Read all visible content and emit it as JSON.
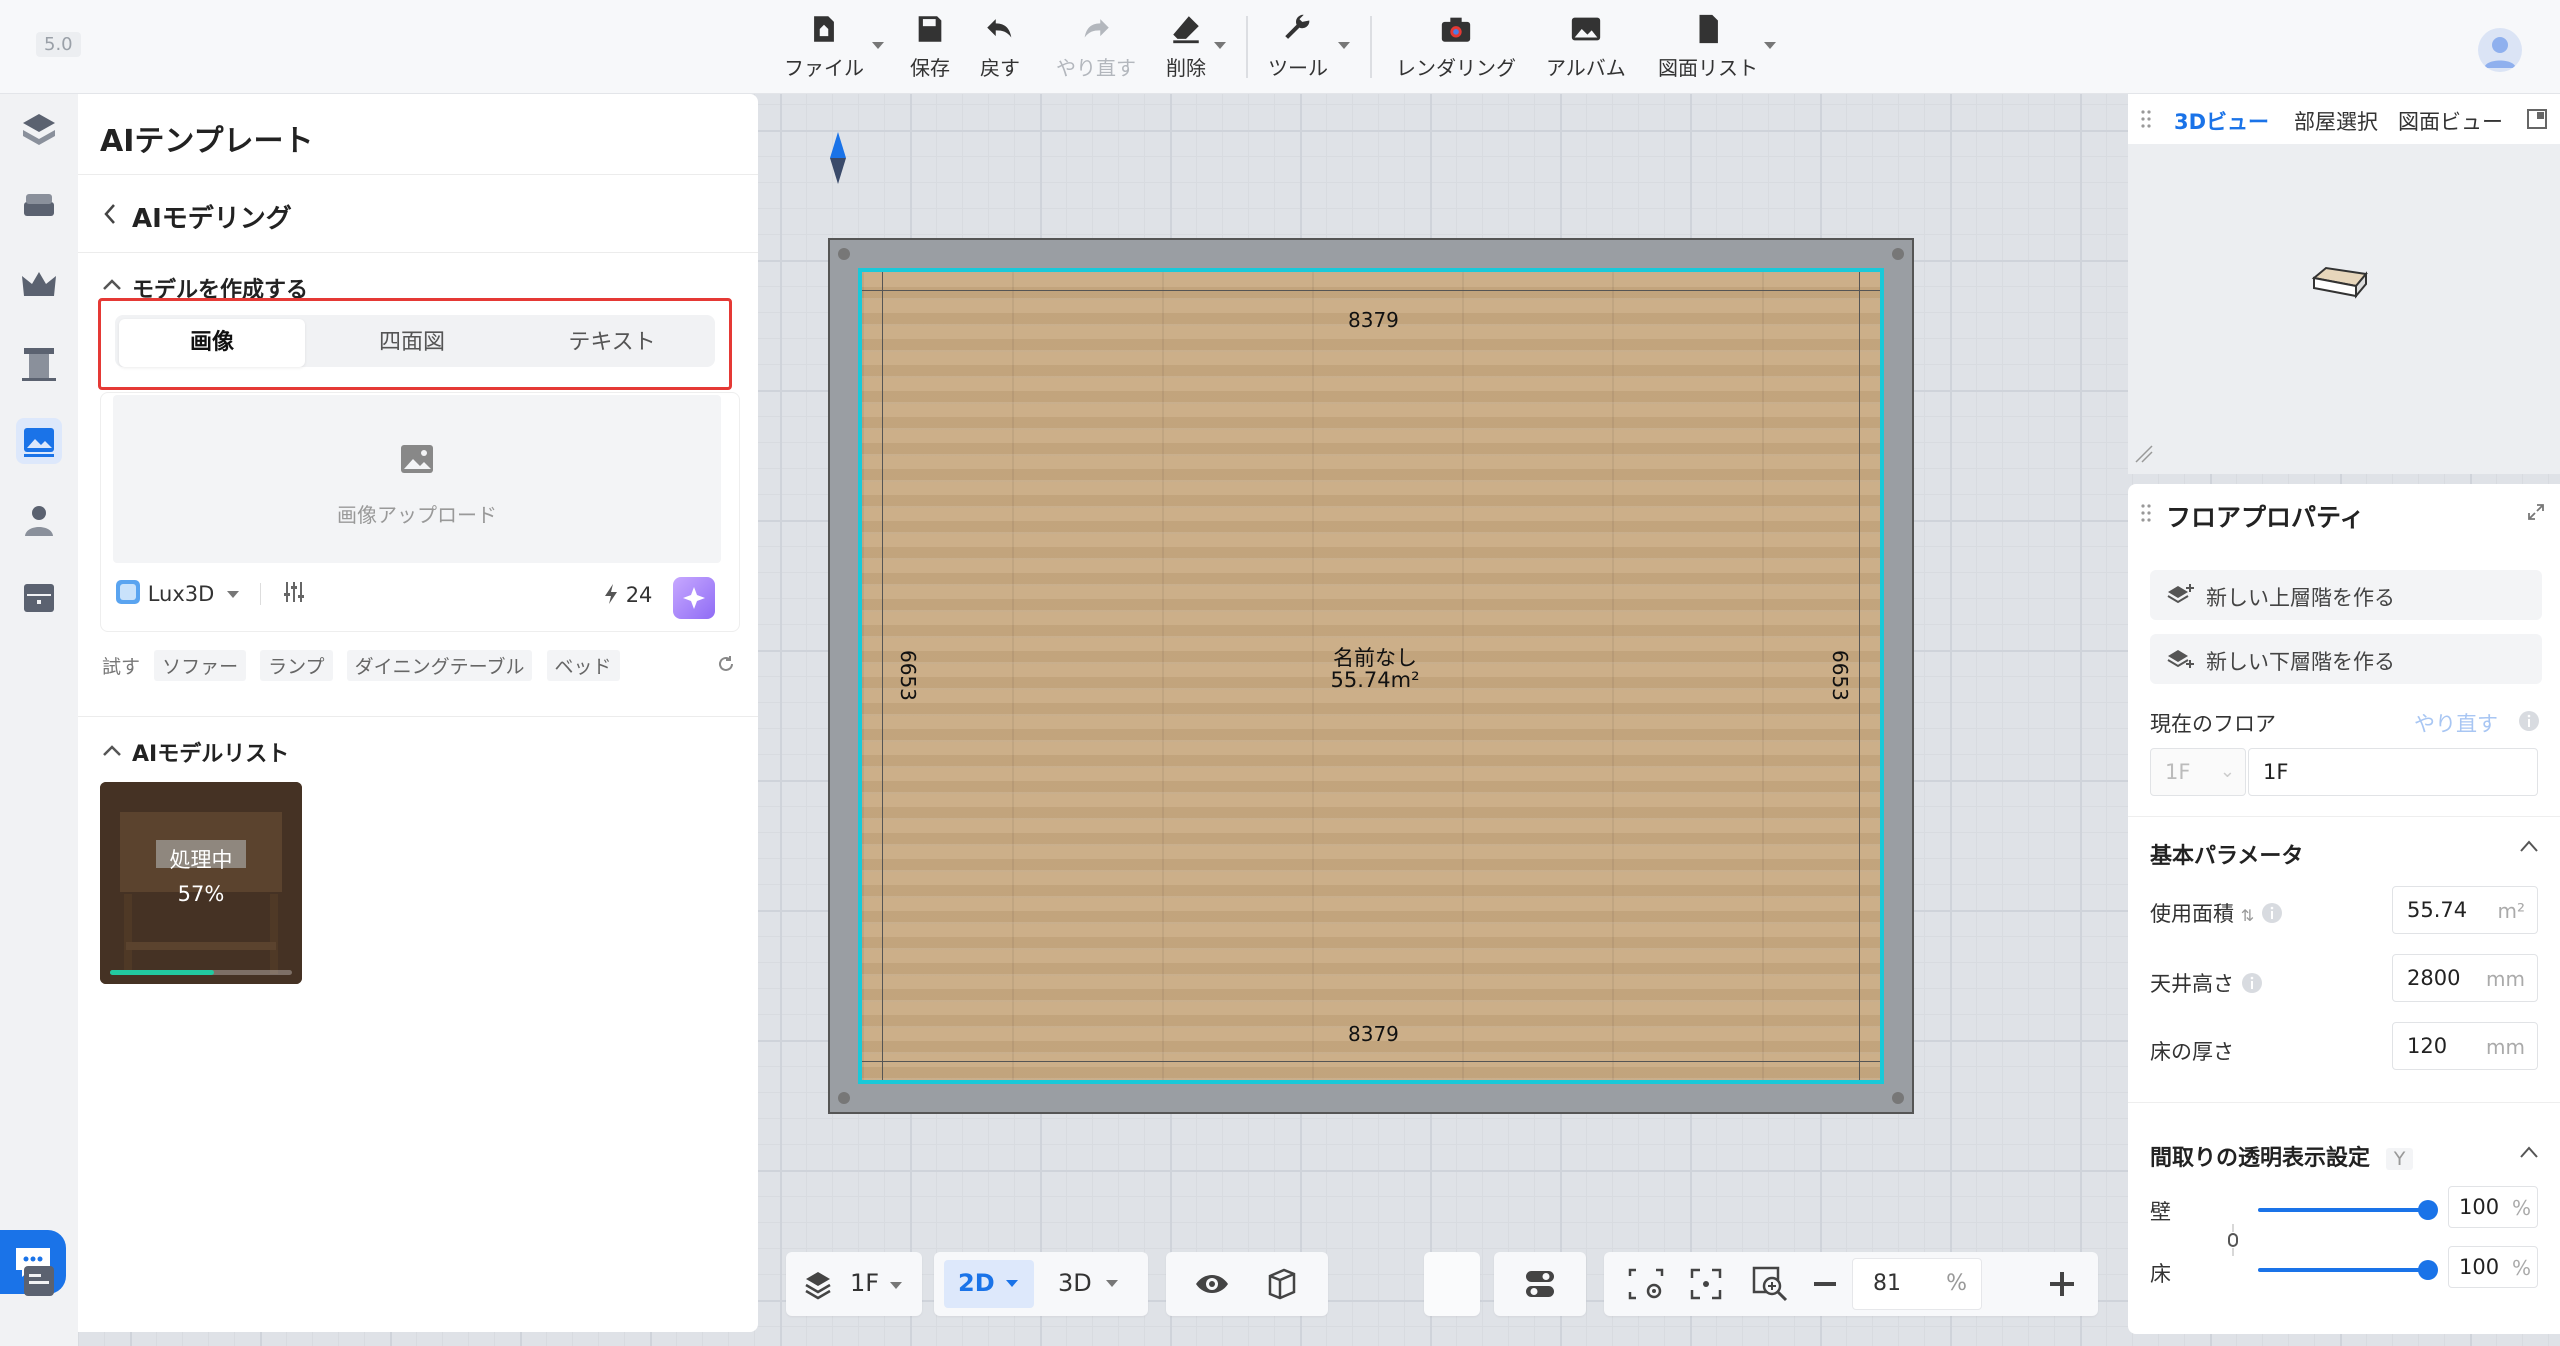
{
  "version": "5.0",
  "toolbar": {
    "file": "ファイル",
    "save": "保存",
    "undo": "戻す",
    "redo": "やり直す",
    "delete": "削除",
    "tools": "ツール",
    "render": "レンダリング",
    "album": "アルバム",
    "drawing_list": "図面リスト"
  },
  "left_panel": {
    "title": "AIテンプレート",
    "subtitle": "AIモデリング",
    "create_section": "モデルを作成する",
    "tabs": [
      "画像",
      "四面図",
      "テキスト"
    ],
    "active_tab": "画像",
    "upload_label": "画像アップロード",
    "model_select": "Lux3D",
    "credits": "24",
    "try_label": "試す",
    "suggestions": [
      "ソファー",
      "ランプ",
      "ダイニングテーブル",
      "ベッド"
    ],
    "model_list_section": "AIモデルリスト",
    "model_item": {
      "status": "処理中",
      "progress": "57%"
    }
  },
  "plan": {
    "dim_top": "8379",
    "dim_bottom": "8379",
    "dim_left": "6653",
    "dim_right": "6653",
    "room_name": "名前なし",
    "room_area": "55.74m²"
  },
  "view3d": {
    "tabs": [
      "3Dビュー",
      "部屋選択",
      "図面ビュー"
    ],
    "active_tab": "3Dビュー"
  },
  "props": {
    "title": "フロアプロパティ",
    "new_upper": "新しい上層階を作る",
    "new_lower": "新しい下層階を作る",
    "current_floor_label": "現在のフロア",
    "redo_label": "やり直す",
    "floor_prefix": "1F",
    "floor_name": "1F",
    "basic_params": "基本パラメータ",
    "area_label": "使用面積",
    "area_value": "55.74",
    "area_unit": "m²",
    "ceiling_label": "天井高さ",
    "ceiling_value": "2800",
    "ceiling_unit": "mm",
    "floor_thickness_label": "床の厚さ",
    "floor_thickness_value": "120",
    "floor_thickness_unit": "mm",
    "transparency_section": "間取りの透明表示設定",
    "transparency_key": "Y",
    "wall_label": "壁",
    "wall_value": "100",
    "floor_label": "床",
    "floor_value": "100",
    "percent": "%"
  },
  "bottom": {
    "floor": "1F",
    "mode_2d": "2D",
    "mode_3d": "3D",
    "zoom": "81",
    "zoom_unit": "%"
  },
  "colors": {
    "accent": "#1a73e8",
    "highlight": "#e53935",
    "room_outline": "#19c9d9"
  }
}
